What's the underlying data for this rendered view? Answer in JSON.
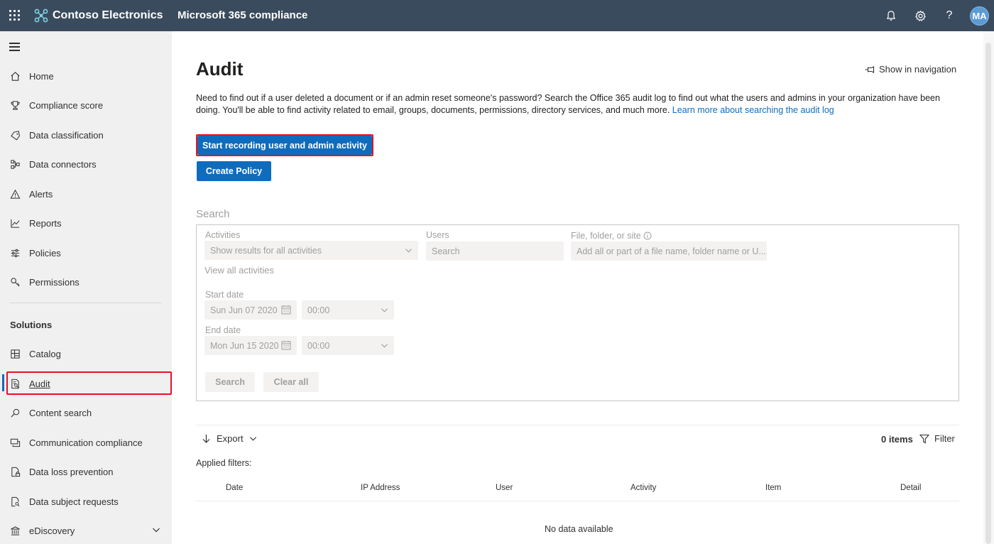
{
  "header": {
    "org_name": "Contoso Electronics",
    "app_title": "Microsoft 365 compliance",
    "user_initials": "MA",
    "bar_color": "#3b4b5e"
  },
  "sidebar": {
    "items": [
      {
        "label": "Home",
        "icon": "home-icon"
      },
      {
        "label": "Compliance score",
        "icon": "trophy-icon"
      },
      {
        "label": "Data classification",
        "icon": "tag-icon"
      },
      {
        "label": "Data connectors",
        "icon": "connector-icon"
      },
      {
        "label": "Alerts",
        "icon": "warning-icon"
      },
      {
        "label": "Reports",
        "icon": "chart-line-icon"
      },
      {
        "label": "Policies",
        "icon": "sliders-icon"
      },
      {
        "label": "Permissions",
        "icon": "key-icon"
      }
    ],
    "solutions_label": "Solutions",
    "solutions": [
      {
        "label": "Catalog",
        "icon": "catalog-icon"
      },
      {
        "label": "Audit",
        "icon": "audit-icon",
        "active": true
      },
      {
        "label": "Content search",
        "icon": "search-icon"
      },
      {
        "label": "Communication compliance",
        "icon": "chat-icon"
      },
      {
        "label": "Data loss prevention",
        "icon": "document-lock-icon"
      },
      {
        "label": "Data subject requests",
        "icon": "document-search-icon"
      },
      {
        "label": "eDiscovery",
        "icon": "bank-icon"
      }
    ]
  },
  "main": {
    "title": "Audit",
    "show_in_nav": "Show in navigation",
    "description": "Need to find out if a user deleted a document or if an admin reset someone's password? Search the Office 365 audit log to find out what the users and admins in your organization have been doing. You'll be able to find activity related to email, groups, documents, permissions, directory services, and much more.",
    "learn_more": "Learn more about searching the audit log",
    "start_recording_label": "Start recording user and admin activity",
    "create_policy_label": "Create Policy",
    "accent_color": "#0f6cbd"
  },
  "search": {
    "heading": "Search",
    "activities_label": "Activities",
    "activities_value": "Show results for all activities",
    "users_label": "Users",
    "users_placeholder": "Search",
    "file_label": "File, folder, or site",
    "file_placeholder": "Add all or part of a file name, folder name or U...",
    "view_all": "View all activities",
    "start_date_label": "Start date",
    "start_date": "Sun Jun 07 2020",
    "start_time": "00:00",
    "end_date_label": "End date",
    "end_date": "Mon Jun 15 2020",
    "end_time": "00:00",
    "search_button": "Search",
    "clear_button": "Clear all"
  },
  "results": {
    "export_label": "Export",
    "items_count": "0 items",
    "filter_label": "Filter",
    "applied_filters": "Applied filters:",
    "columns": [
      "Date",
      "IP Address",
      "User",
      "Activity",
      "Item",
      "Detail"
    ],
    "empty_text": "No data available"
  }
}
